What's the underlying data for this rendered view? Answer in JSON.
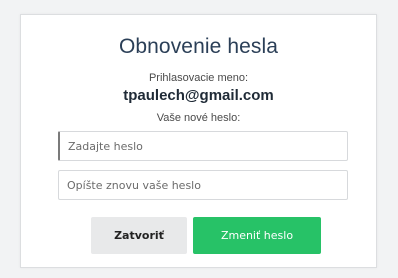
{
  "dialog": {
    "title": "Obnovenie hesla",
    "login_label": "Prihlasovacie meno:",
    "login_value": "tpaulech@gmail.com",
    "new_password_label": "Vaše nové heslo:",
    "new_password_placeholder": "Zadajte heslo",
    "repeat_password_placeholder": "Opíšte znovu vaše heslo",
    "close_button": "Zatvoriť",
    "change_button": "Zmeniť heslo"
  },
  "colors": {
    "title": "#2b3f57",
    "primary_button": "#27c267",
    "secondary_button": "#e8e9ea"
  }
}
